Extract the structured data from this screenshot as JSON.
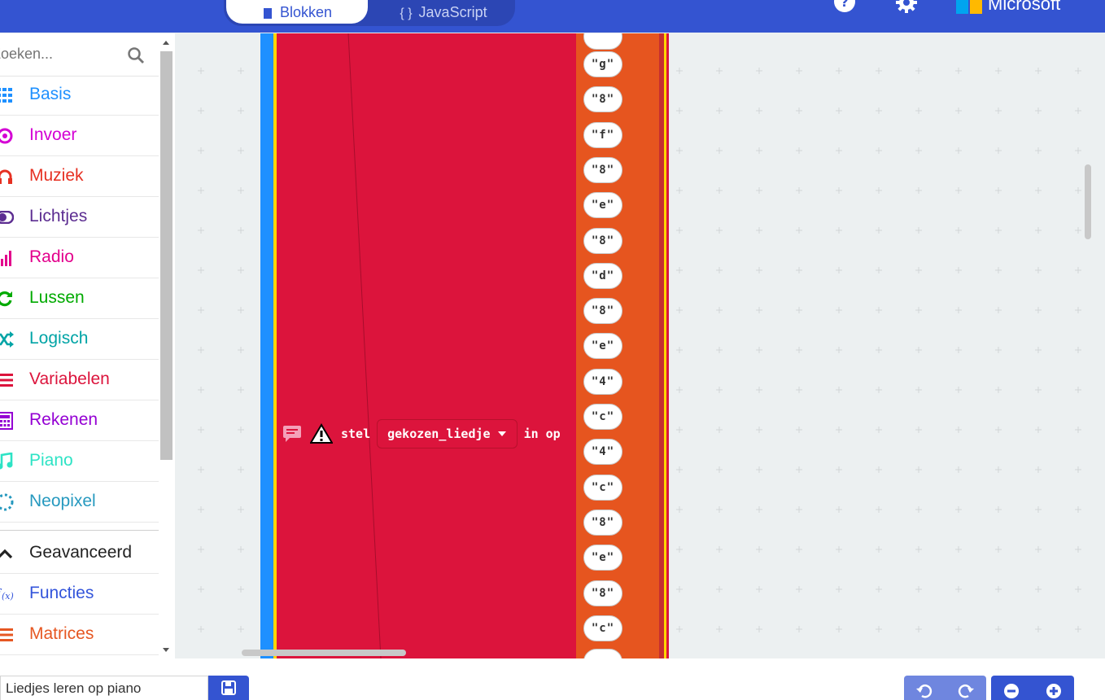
{
  "header": {
    "tabs": [
      {
        "label": "Blokken",
        "selected": true
      },
      {
        "label": "JavaScript",
        "selected": false
      }
    ],
    "help_icon": "question-circle-icon",
    "settings_icon": "gear-icon",
    "brand": "Microsoft"
  },
  "sidebar": {
    "search_placeholder": "Zoeken...",
    "categories": [
      {
        "label": "Basis",
        "color": "#1e90ff",
        "icon": "grid-icon"
      },
      {
        "label": "Invoer",
        "color": "#d400d4",
        "icon": "target-icon"
      },
      {
        "label": "Muziek",
        "color": "#e63022",
        "icon": "headphones-icon"
      },
      {
        "label": "Lichtjes",
        "color": "#5c2d91",
        "icon": "toggle-icon"
      },
      {
        "label": "Radio",
        "color": "#e3008c",
        "icon": "signal-bars-icon"
      },
      {
        "label": "Lussen",
        "color": "#00aa00",
        "icon": "refresh-icon"
      },
      {
        "label": "Logisch",
        "color": "#00a4a6",
        "icon": "shuffle-icon"
      },
      {
        "label": "Variabelen",
        "color": "#dc143c",
        "icon": "lines-icon"
      },
      {
        "label": "Rekenen",
        "color": "#9400d3",
        "icon": "calculator-icon"
      },
      {
        "label": "Piano",
        "color": "#2de3c5",
        "icon": "music-note-icon"
      },
      {
        "label": "Neopixel",
        "color": "#2699bf",
        "icon": "dotted-ring-icon"
      }
    ],
    "advanced": [
      {
        "label": "Geavanceerd",
        "color": "#222222",
        "icon": "chevron-up-icon"
      },
      {
        "label": "Functies",
        "color": "#3455db",
        "icon": "function-icon"
      },
      {
        "label": "Matrices",
        "color": "#e65722",
        "icon": "lines-icon"
      }
    ]
  },
  "workspace": {
    "statement": {
      "keyword": "stel",
      "variable": "gekozen_liedje",
      "suffix": "in op"
    },
    "strings": [
      "\"g\"",
      "\"8\"",
      "\"f\"",
      "\"8\"",
      "\"e\"",
      "\"8\"",
      "\"d\"",
      "\"8\"",
      "\"e\"",
      "\"4\"",
      "\"c\"",
      "\"4\"",
      "\"c\"",
      "\"8\"",
      "\"e\"",
      "\"8\"",
      "\"c\""
    ]
  },
  "footer": {
    "project_name": "Liedjes leren op piano"
  }
}
